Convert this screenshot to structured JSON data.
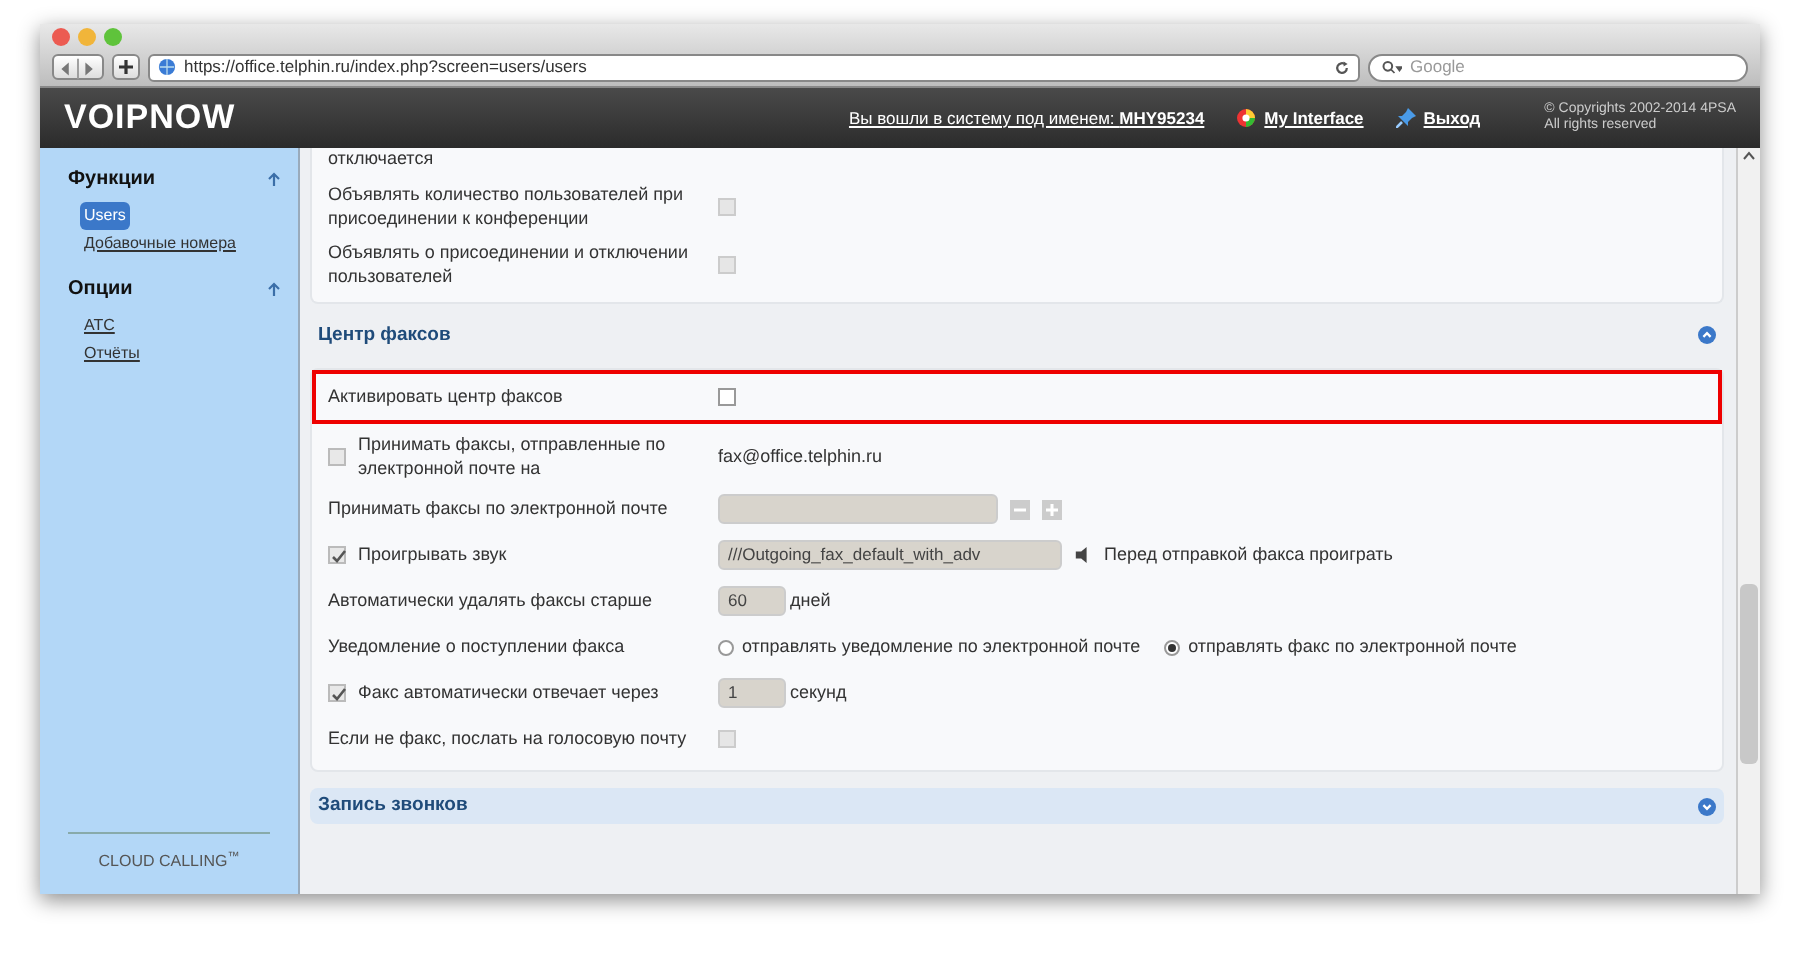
{
  "browser": {
    "url": "https://office.telphin.ru/index.php?screen=users/users",
    "search_placeholder": "Google"
  },
  "header": {
    "logo": "VOIPNOW",
    "login": "Вы вошли в систему под именем: **MHY95234**",
    "links": [
      {
        "kind": "interface",
        "label": "My Interface"
      },
      {
        "kind": "logout",
        "label": "Выход"
      }
    ],
    "copyright": [
      "© Copyrights 2002-2014 4PSA",
      "All rights reserved"
    ]
  },
  "sidebar": {
    "groups": [
      {
        "title": "Функции",
        "expanded": true,
        "items": [
          {
            "label": "Users",
            "selected": true
          },
          {
            "label": "Добавочные номера",
            "selected": false
          }
        ]
      },
      {
        "title": "Опции",
        "expanded": true,
        "items": [
          {
            "label": "АТС",
            "selected": false
          },
          {
            "label": "Отчёты",
            "selected": false
          }
        ]
      }
    ],
    "footer": "CLOUD CALLING$^{™}$"
  },
  "sections": [
    {
      "rows": [
        {
          "kind": "continuation",
          "label": "отключается"
        },
        {
          "kind": "checkbox",
          "label": "Объявлять количество пользователей при присоединении к конференции",
          "checked": false,
          "disabled": true
        },
        {
          "kind": "checkbox",
          "label": "Объявлять о присоединении и отключении пользователей",
          "checked": false,
          "disabled": true
        }
      ]
    },
    {
      "title": "Центр факсов",
      "expanded": true,
      "rows": [
        {
          "kind": "checkbox",
          "label": "Активировать центр факсов",
          "checked": false,
          "disabled": false,
          "highlighted": true
        },
        {
          "kind": "text",
          "label": "Принимать факсы, отправленные по электронной почте на",
          "label_check": {
            "checked": false
          },
          "value": "fax@office.telphin.ru"
        },
        {
          "kind": "list_input",
          "label": "Принимать факсы по электронной почте"
        },
        {
          "kind": "sound",
          "label": "Проигрывать звук",
          "label_check": {
            "checked": true
          },
          "value": "///Outgoing_fax_default_with_adv",
          "note": "Перед отправкой факса проиграть"
        },
        {
          "kind": "number",
          "label": "Автоматически удалять факсы старше",
          "value": "60",
          "unit": "дней"
        },
        {
          "kind": "radio",
          "label": "Уведомление о поступлении факса",
          "options": [
            {
              "label": "отправлять уведомление по электронной почте",
              "selected": false
            },
            {
              "label": "отправлять факс по электронной почте",
              "selected": true
            }
          ]
        },
        {
          "kind": "number",
          "label": "Факс автоматически отвечает через",
          "label_check": {
            "checked": true
          },
          "value": "1",
          "unit": "секунд"
        },
        {
          "kind": "checkbox",
          "label": "Если не факс, послать на голосовую почту",
          "checked": false,
          "disabled": true
        }
      ]
    },
    {
      "title": "Запись звонков",
      "expanded": false
    }
  ]
}
